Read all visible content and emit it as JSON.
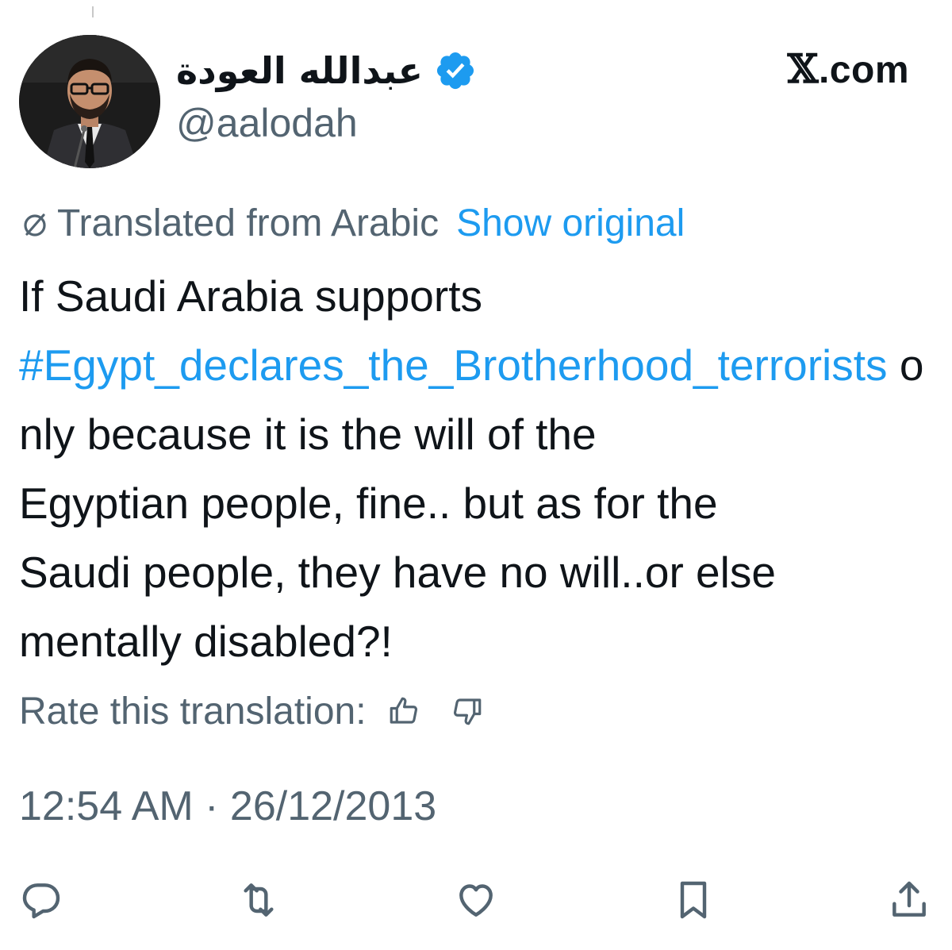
{
  "author": {
    "display_name": "عبدالله العودة",
    "handle": "@aalodah",
    "verified": true
  },
  "site": {
    "label_mark": "𝕏",
    "label_rest": ".com"
  },
  "translation": {
    "translated_label": "Translated from Arabic",
    "show_original_label": "Show original"
  },
  "tweet": {
    "line1": "If Saudi Arabia supports",
    "hashtag": "#Egypt_declares_the_Brotherhood_terrorists",
    "after_hashtag": " only because it is the will of the",
    "line3": "Egyptian people, fine.. but as for the",
    "line4": "Saudi people, they have no will..or else",
    "line5": "mentally disabled?!"
  },
  "rate": {
    "label": "Rate this translation:"
  },
  "timestamp": "12:54 AM · 26/12/2013",
  "icons": {
    "verified": "verified-badge-icon",
    "translate": "translate-icon",
    "thumbs_up": "thumbs-up-icon",
    "thumbs_down": "thumbs-down-icon",
    "reply": "reply-icon",
    "retweet": "retweet-icon",
    "like": "heart-icon",
    "bookmark": "bookmark-icon",
    "share": "share-icon"
  },
  "colors": {
    "accent": "#1d9bf0",
    "text": "#0f1419",
    "muted": "#536471",
    "background": "#ffffff"
  }
}
